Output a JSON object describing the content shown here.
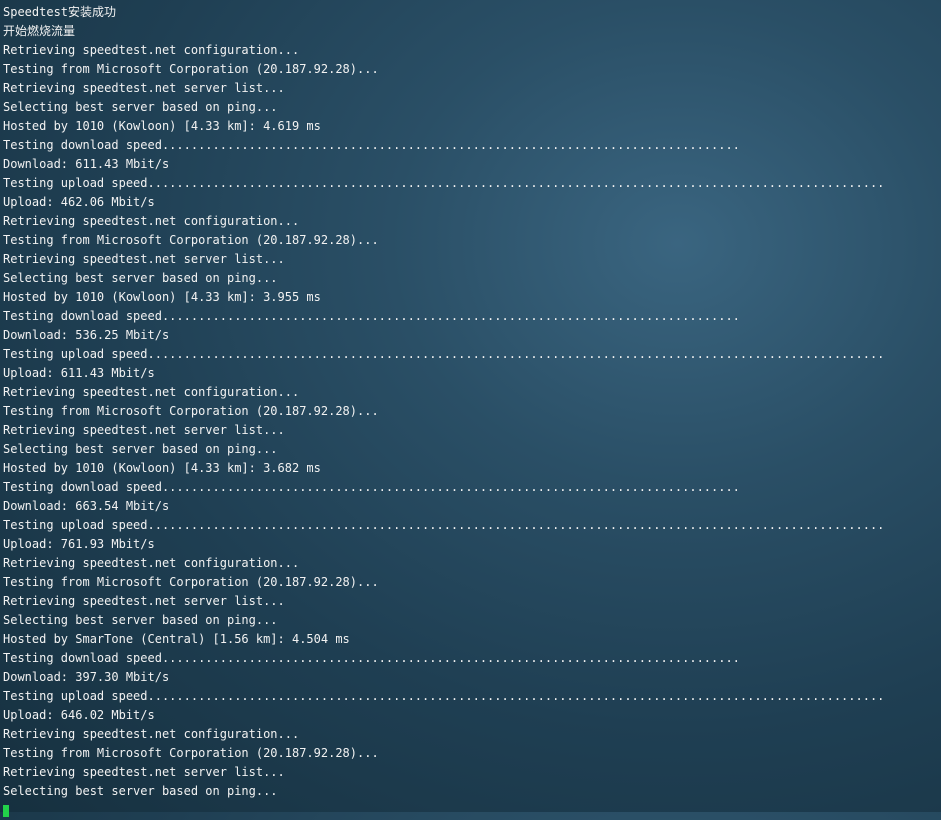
{
  "terminal": {
    "lines": [
      "Speedtest安装成功",
      "开始燃烧流量",
      "Retrieving speedtest.net configuration...",
      "Testing from Microsoft Corporation (20.187.92.28)...",
      "Retrieving speedtest.net server list...",
      "Selecting best server based on ping...",
      "Hosted by 1010 (Kowloon) [4.33 km]: 4.619 ms",
      "Testing download speed................................................................................",
      "Download: 611.43 Mbit/s",
      "Testing upload speed......................................................................................................",
      "Upload: 462.06 Mbit/s",
      "Retrieving speedtest.net configuration...",
      "Testing from Microsoft Corporation (20.187.92.28)...",
      "Retrieving speedtest.net server list...",
      "Selecting best server based on ping...",
      "Hosted by 1010 (Kowloon) [4.33 km]: 3.955 ms",
      "Testing download speed................................................................................",
      "Download: 536.25 Mbit/s",
      "Testing upload speed......................................................................................................",
      "Upload: 611.43 Mbit/s",
      "Retrieving speedtest.net configuration...",
      "Testing from Microsoft Corporation (20.187.92.28)...",
      "Retrieving speedtest.net server list...",
      "Selecting best server based on ping...",
      "Hosted by 1010 (Kowloon) [4.33 km]: 3.682 ms",
      "Testing download speed................................................................................",
      "Download: 663.54 Mbit/s",
      "Testing upload speed......................................................................................................",
      "Upload: 761.93 Mbit/s",
      "Retrieving speedtest.net configuration...",
      "Testing from Microsoft Corporation (20.187.92.28)...",
      "Retrieving speedtest.net server list...",
      "Selecting best server based on ping...",
      "Hosted by SmarTone (Central) [1.56 km]: 4.504 ms",
      "Testing download speed................................................................................",
      "Download: 397.30 Mbit/s",
      "Testing upload speed......................................................................................................",
      "Upload: 646.02 Mbit/s",
      "Retrieving speedtest.net configuration...",
      "Testing from Microsoft Corporation (20.187.92.28)...",
      "Retrieving speedtest.net server list...",
      "Selecting best server based on ping..."
    ],
    "cursor_color": "#22d24a",
    "text_color": "#f2f2f2"
  }
}
